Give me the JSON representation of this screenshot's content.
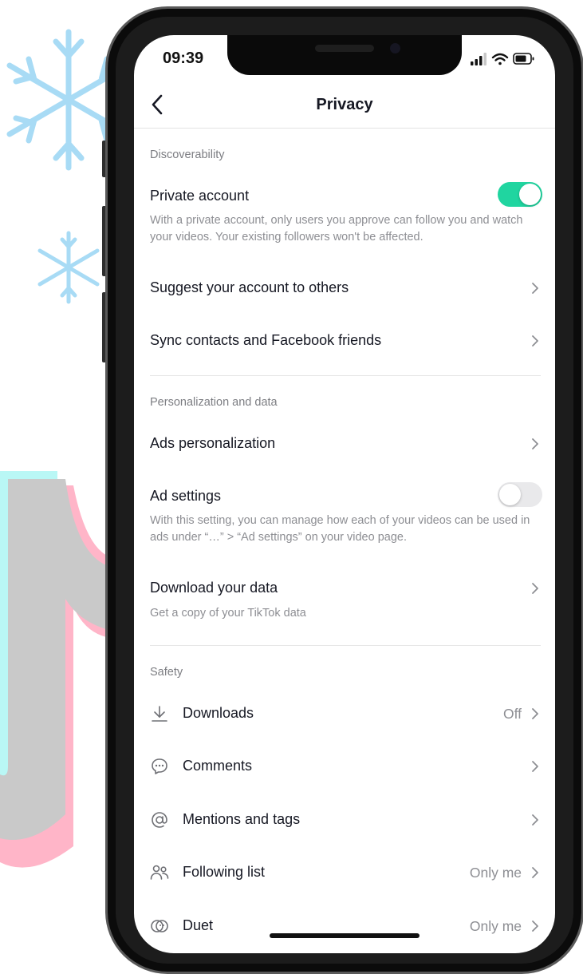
{
  "colors": {
    "accent": "#20d5a0",
    "toggle_off": "#e9e9eb",
    "snowflake": "#a8dbf5",
    "brand_cyan": "#b9f7f5",
    "brand_pink": "#ffb5c8",
    "ring_blue": "#36b5e8"
  },
  "status_bar": {
    "time": "09:39"
  },
  "header": {
    "title": "Privacy",
    "back_icon": "chevron-left-icon"
  },
  "sections": {
    "discoverability": "Discoverability",
    "personalization": "Personalization and data",
    "safety": "Safety"
  },
  "items": {
    "private_account": {
      "label": "Private account",
      "toggle_on": true,
      "description": "With a private account, only users you approve can follow you and watch your videos. Your existing followers won't be affected."
    },
    "suggest_account": {
      "label": "Suggest your account to others"
    },
    "sync_contacts": {
      "label": "Sync contacts and Facebook friends"
    },
    "ads_personalization": {
      "label": "Ads personalization"
    },
    "ad_settings": {
      "label": "Ad settings",
      "toggle_on": false,
      "description": "With this setting, you can manage how each of your videos can be used in ads under “…” > “Ad settings” on your video page."
    },
    "download_data": {
      "label": "Download your data",
      "description": "Get a copy of your TikTok data"
    },
    "downloads": {
      "label": "Downloads",
      "value": "Off",
      "icon": "download-icon"
    },
    "comments": {
      "label": "Comments",
      "icon": "comment-icon"
    },
    "mentions": {
      "label": "Mentions and tags",
      "icon": "at-sign-icon"
    },
    "following_list": {
      "label": "Following list",
      "value": "Only me",
      "icon": "people-icon"
    },
    "duet": {
      "label": "Duet",
      "value": "Only me",
      "icon": "duet-icon"
    }
  }
}
